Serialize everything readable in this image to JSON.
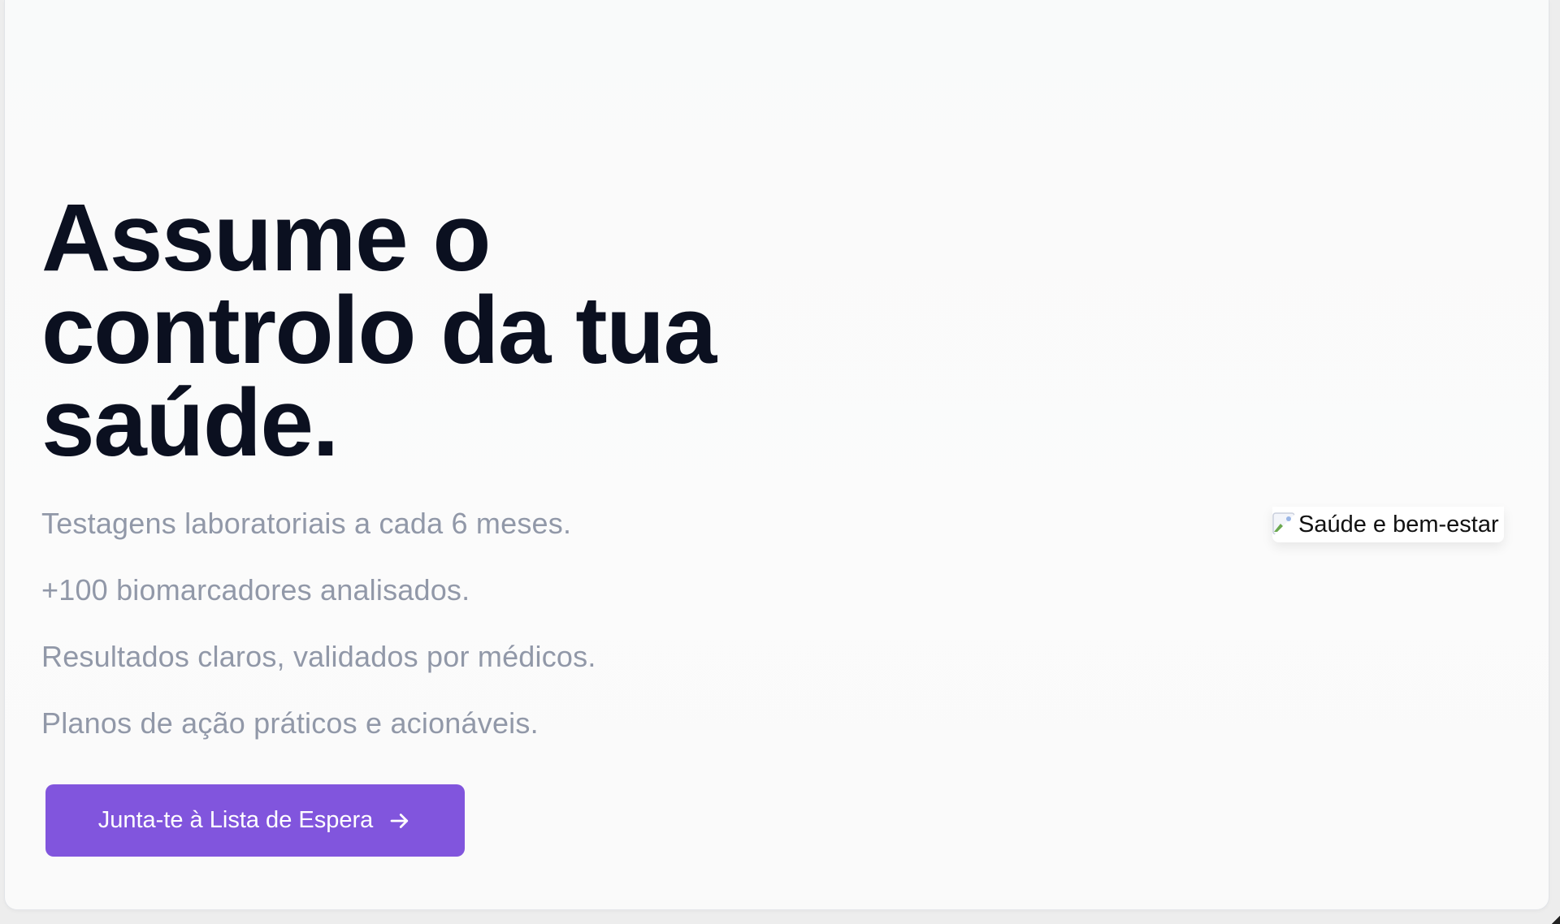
{
  "hero": {
    "headline": "Assume o controlo da tua saúde.",
    "features": [
      "Testagens laboratoriais a cada 6 meses.",
      "+100 biomarcadores analisados.",
      "Resultados claros, validados por médicos.",
      "Planos de ação práticos e acionáveis."
    ],
    "cta_label": "Junta-te à Lista de Espera",
    "cta_icon": "arrow-right-icon"
  },
  "hero_image": {
    "alt_text": "Saúde e bem-estar",
    "icon": "broken-image-icon"
  },
  "colors": {
    "accent": "#8155dd",
    "headline": "#0b1020",
    "muted_text": "#9198a8",
    "background": "#f9fafa"
  }
}
